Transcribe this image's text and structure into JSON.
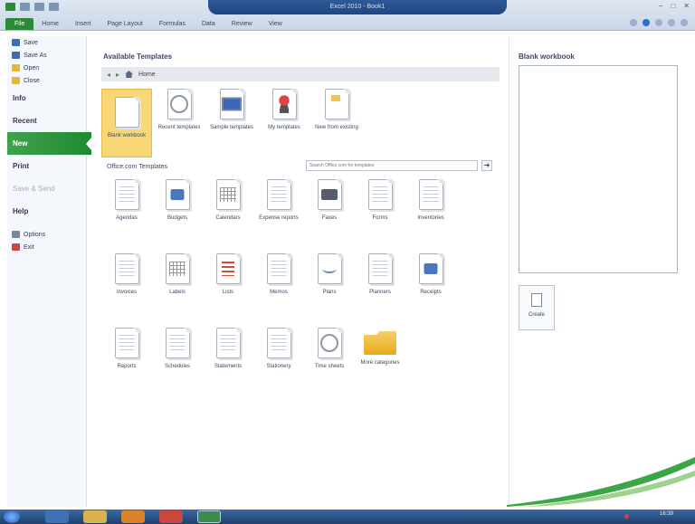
{
  "window": {
    "title": "Excel 2010 - Book1",
    "controls": [
      "–",
      "□",
      "✕"
    ]
  },
  "ribbon_tabs": [
    "File",
    "Home",
    "Insert",
    "Page Layout",
    "Formulas",
    "Data",
    "Review",
    "View"
  ],
  "backstage_nav": [
    {
      "label": "Save",
      "type": "small",
      "icon": "save-icon",
      "color": "#3c6fb5"
    },
    {
      "label": "Save As",
      "type": "small",
      "icon": "save-as-icon",
      "color": "#3c6fb5"
    },
    {
      "label": "Open",
      "type": "small",
      "icon": "open-folder-icon",
      "color": "#e7b537"
    },
    {
      "label": "Close",
      "type": "small",
      "icon": "close-folder-icon",
      "color": "#e7b537"
    },
    {
      "label": "Info",
      "type": "big"
    },
    {
      "label": "Recent",
      "type": "big"
    },
    {
      "label": "New",
      "type": "big",
      "active": true
    },
    {
      "label": "Print",
      "type": "big"
    },
    {
      "label": "Save & Send",
      "type": "big",
      "disabled": true
    },
    {
      "label": "Help",
      "type": "big"
    },
    {
      "label": "Options",
      "type": "small",
      "icon": "options-icon",
      "color": "#7b8796"
    },
    {
      "label": "Exit",
      "type": "small",
      "icon": "exit-icon",
      "color": "#d4443a"
    }
  ],
  "main": {
    "available_title": "Available Templates",
    "breadcrumb": "Home",
    "top_templates": [
      {
        "label": "Blank workbook",
        "icon": "blank-doc-icon",
        "selected": true
      },
      {
        "label": "Recent templates",
        "icon": "recent-clock-icon"
      },
      {
        "label": "Sample templates",
        "icon": "sample-monitor-icon"
      },
      {
        "label": "My templates",
        "icon": "my-templates-person-icon"
      },
      {
        "label": "New from existing",
        "icon": "new-from-existing-icon"
      }
    ],
    "officecom_title": "Office.com Templates",
    "search_placeholder": "Search Office.com for templates",
    "search_button": "➜",
    "officecom_templates": [
      {
        "label": "Agendas",
        "icon": "agendas-icon"
      },
      {
        "label": "Budgets",
        "icon": "budgets-icon"
      },
      {
        "label": "Calendars",
        "icon": "calendars-icon"
      },
      {
        "label": "Expense reports",
        "icon": "expense-reports-icon"
      },
      {
        "label": "Faxes",
        "icon": "faxes-icon"
      },
      {
        "label": "Forms",
        "icon": "forms-icon"
      },
      {
        "label": "Inventories",
        "icon": "inventories-icon"
      },
      {
        "label": "Invoices",
        "icon": "invoices-icon"
      },
      {
        "label": "Labels",
        "icon": "labels-icon"
      },
      {
        "label": "Lists",
        "icon": "lists-icon"
      },
      {
        "label": "Memos",
        "icon": "memos-icon"
      },
      {
        "label": "Plans",
        "icon": "plans-icon"
      },
      {
        "label": "Planners",
        "icon": "planners-icon"
      },
      {
        "label": "Receipts",
        "icon": "receipts-icon"
      },
      {
        "label": "Reports",
        "icon": "reports-icon"
      },
      {
        "label": "Schedules",
        "icon": "schedules-icon"
      },
      {
        "label": "Statements",
        "icon": "statements-icon"
      },
      {
        "label": "Stationery",
        "icon": "stationery-icon"
      },
      {
        "label": "Time sheets",
        "icon": "time-sheets-icon"
      },
      {
        "label": "More categories",
        "icon": "more-categories-folder-icon"
      }
    ]
  },
  "preview": {
    "title": "Blank workbook",
    "create_label": "Create"
  },
  "taskbar": {
    "clock": "16:39"
  }
}
